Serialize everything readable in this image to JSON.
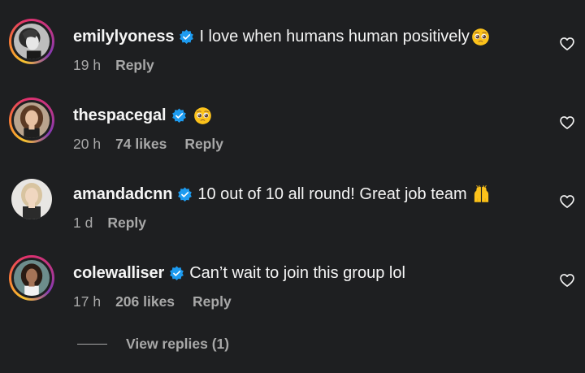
{
  "colors": {
    "background": "#1e1f21",
    "primary_text": "#f5f5f5",
    "secondary_text": "#a8a8a8",
    "verified_badge": "#1d9bf0"
  },
  "comments": [
    {
      "username": "emilylyoness",
      "verified": true,
      "text": "I love when humans human positively",
      "emoji": "pleading-face-emoji",
      "time": "19 h",
      "likes": "",
      "reply_label": "Reply",
      "story_ring": true
    },
    {
      "username": "thespacegal",
      "verified": true,
      "text": "",
      "emoji": "pleading-face-emoji",
      "time": "20 h",
      "likes": "74 likes",
      "reply_label": "Reply",
      "story_ring": true
    },
    {
      "username": "amandadcnn",
      "verified": true,
      "text": "10 out of 10 all round! Great job team",
      "emoji": "raising-hands-emoji",
      "time": "1 d",
      "likes": "",
      "reply_label": "Reply",
      "story_ring": false
    },
    {
      "username": "colewalliser",
      "verified": true,
      "text": "Can’t wait to join this group lol",
      "emoji": "",
      "time": "17 h",
      "likes": "206 likes",
      "reply_label": "Reply",
      "story_ring": true
    }
  ],
  "view_replies": {
    "label": "View replies (1)"
  },
  "icons": {
    "like": "heart-outline-icon",
    "verified": "verified-badge-icon"
  }
}
